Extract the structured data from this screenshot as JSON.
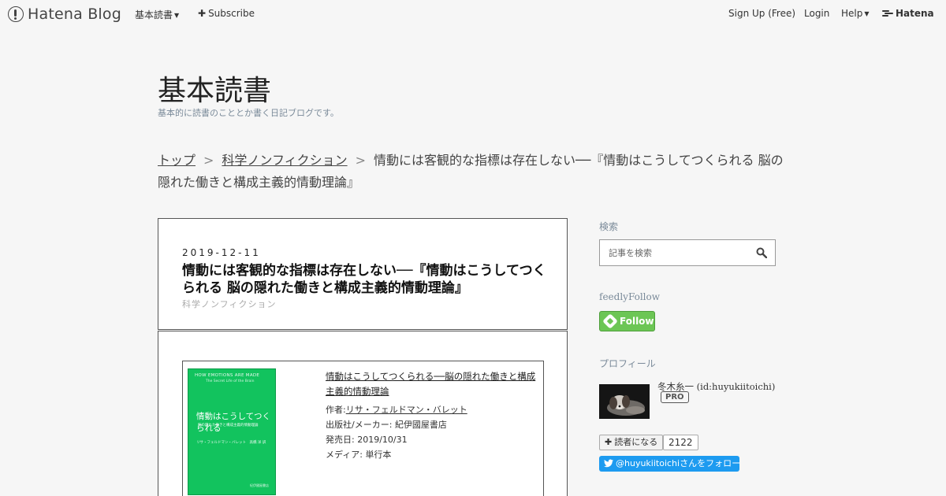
{
  "topbar": {
    "logo": "Hatena Blog",
    "menu_label": "基本読書",
    "subscribe": "Subscribe",
    "signup": "Sign Up (Free)",
    "login": "Login",
    "help": "Help",
    "hatena": "Hatena"
  },
  "header": {
    "title": "基本読書",
    "description": "基本的に読書のこととか書く日記ブログです。"
  },
  "breadcrumb": {
    "top": "トップ",
    "separator": ">",
    "category": "科学ノンフィクション",
    "current": "情動には客観的な指標は存在しない──『情動はこうしてつくられる 脳の隠れた働きと構成主義的情動理論』"
  },
  "article": {
    "date": "2019-12-11",
    "title": "情動には客観的な指標は存在しない──『情動はこうしてつくられる 脳の隠れた働きと構成主義的情動理論』",
    "category": "科学ノンフィクション",
    "book": {
      "cover_title_en": "HOW EMOTIONS ARE MADE",
      "cover_subtitle_en": "The Secret Life of the Brain",
      "cover_title_jp": "情動はこうしてつくられる",
      "cover_subtitle_jp": "脳の隠れた働きと構成主義的情動理論",
      "cover_author": "リサ・フェルドマン・バレット　高橋 洋 訳",
      "cover_publisher": "紀伊國屋書店",
      "title": "情動はこうしてつくられる──脳の隠れた働きと構成主義的情動理論",
      "author_label": "作者:",
      "author": "リサ・フェルドマン・バレット",
      "publisher_label": "出版社/メーカー:",
      "publisher": "紀伊國屋書店",
      "release_label": "発売日:",
      "release": "2019/10/31",
      "media_label": "メディア:",
      "media": "単行本"
    }
  },
  "sidebar": {
    "search_label": "検索",
    "search_placeholder": "記事を検索",
    "feedly_label": "feedlyFollow",
    "feedly_button": "Follow",
    "profile_label": "プロフィール",
    "profile_name": "冬木糸一 (id:huyukiitoichi)",
    "pro_badge": "PRO",
    "reader_button": "読者になる",
    "reader_count": "2122",
    "twitter_button": "@huyukiitoichiさんをフォロー"
  }
}
